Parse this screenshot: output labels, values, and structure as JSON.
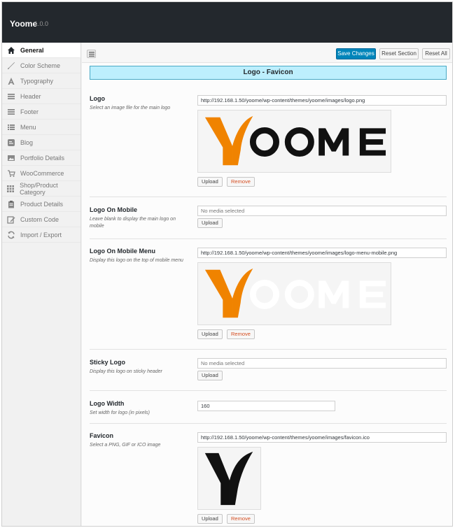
{
  "app": {
    "name": "Yoome",
    "version": "1.0.0"
  },
  "sidebar": {
    "items": [
      {
        "label": "General",
        "icon": "home-icon"
      },
      {
        "label": "Color Scheme",
        "icon": "brush-icon"
      },
      {
        "label": "Typography",
        "icon": "typography-icon"
      },
      {
        "label": "Header",
        "icon": "header-menu-icon"
      },
      {
        "label": "Footer",
        "icon": "footer-menu-icon"
      },
      {
        "label": "Menu",
        "icon": "list-icon"
      },
      {
        "label": "Blog",
        "icon": "blog-icon"
      },
      {
        "label": "Portfolio Details",
        "icon": "image-icon"
      },
      {
        "label": "WooCommerce",
        "icon": "cart-icon"
      },
      {
        "label": "Shop/Product Category",
        "icon": "grid-icon"
      },
      {
        "label": "Product Details",
        "icon": "clipboard-icon"
      },
      {
        "label": "Custom Code",
        "icon": "edit-icon"
      },
      {
        "label": "Import / Export",
        "icon": "refresh-icon"
      }
    ]
  },
  "toolbar": {
    "save_label": "Save Changes",
    "reset_section_label": "Reset Section",
    "reset_all_label": "Reset All"
  },
  "section": {
    "title": "Logo - Favicon"
  },
  "fields": {
    "logo": {
      "label": "Logo",
      "desc": "Select an image file for the main logo",
      "value": "http://192.168.1.50/yoome/wp-content/themes/yoome/images/logo.png",
      "upload": "Upload",
      "remove": "Remove"
    },
    "logo_mobile": {
      "label": "Logo On Mobile",
      "desc": "Leave blank to display the main logo on mobile",
      "placeholder": "No media selected",
      "upload": "Upload"
    },
    "logo_mobile_menu": {
      "label": "Logo On Mobile Menu",
      "desc": "Display this logo on the top of mobile menu",
      "value": "http://192.168.1.50/yoome/wp-content/themes/yoome/images/logo-menu-mobile.png",
      "upload": "Upload",
      "remove": "Remove"
    },
    "sticky_logo": {
      "label": "Sticky Logo",
      "desc": "Display this logo on sticky header",
      "placeholder": "No media selected",
      "upload": "Upload"
    },
    "logo_width": {
      "label": "Logo Width",
      "desc": "Set width for logo (in pixels)",
      "value": "160"
    },
    "favicon": {
      "label": "Favicon",
      "desc": "Select a PNG, GIF or ICO image",
      "value": "http://192.168.1.50/yoome/wp-content/themes/yoome/images/favicon.ico",
      "upload": "Upload",
      "remove": "Remove"
    }
  },
  "logo_text": {
    "letters": "OOME"
  },
  "colors": {
    "accent": "#0085ba",
    "logo_orange": "#f08300",
    "banner_bg": "#bdeffd",
    "topbar": "#23282d"
  }
}
